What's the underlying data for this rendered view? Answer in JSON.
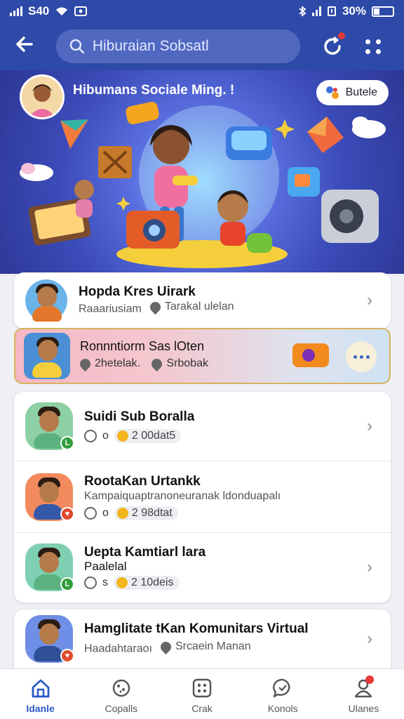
{
  "status_bar": {
    "time": "S40",
    "battery": "30%"
  },
  "search": {
    "placeholder": "Hiburaian Sobsatl"
  },
  "hero": {
    "title": "Hibumans Sociale Ming. !",
    "share_label": "Butele"
  },
  "list": [
    {
      "title": "Hopda Kres Uirark",
      "subtitle": "Raaariusiam",
      "location": "Tarakal ulelan",
      "badge_color": ""
    },
    {
      "title": "Ronnntiorm Sas lOten",
      "count_label": "2hetelak.",
      "location": "Srbobak",
      "highlighted": true
    },
    {
      "title": "Suidi Sub Boralla",
      "meta_value": "o",
      "coins": "2 00dat5",
      "badge_color": "#2e9d3a"
    },
    {
      "title": "RootaKan Urtankk",
      "subtitle": "Kampaiquaptranoneuranak ldonduapalı",
      "meta_value": "o",
      "coins": "2 98dtat",
      "badge_color": "#e04a2b"
    },
    {
      "title": "Uepta Kamtiarl lara",
      "subtitle": "Paalelal",
      "meta_value": "s",
      "coins": "2 10deis",
      "badge_color": "#2e9d3a"
    },
    {
      "title": "Hamglitate tKan Komunitars Virtual",
      "subtitle": "Haadahtaraoı",
      "location": "Srcaein Manan",
      "badge_color": "#e04a2b"
    }
  ],
  "nav": [
    {
      "label": "Idanle",
      "icon": "home-icon",
      "active": true
    },
    {
      "label": "Copalls",
      "icon": "cookie-icon"
    },
    {
      "label": "Crak",
      "icon": "grid-icon"
    },
    {
      "label": "Konols",
      "icon": "chat-bubble-icon"
    },
    {
      "label": "Ulanes",
      "icon": "profile-icon",
      "badge": true
    }
  ],
  "colors": {
    "primary": "#2e4aa8",
    "accent": "#2e59c7",
    "highlight_border": "#d6b35b"
  }
}
